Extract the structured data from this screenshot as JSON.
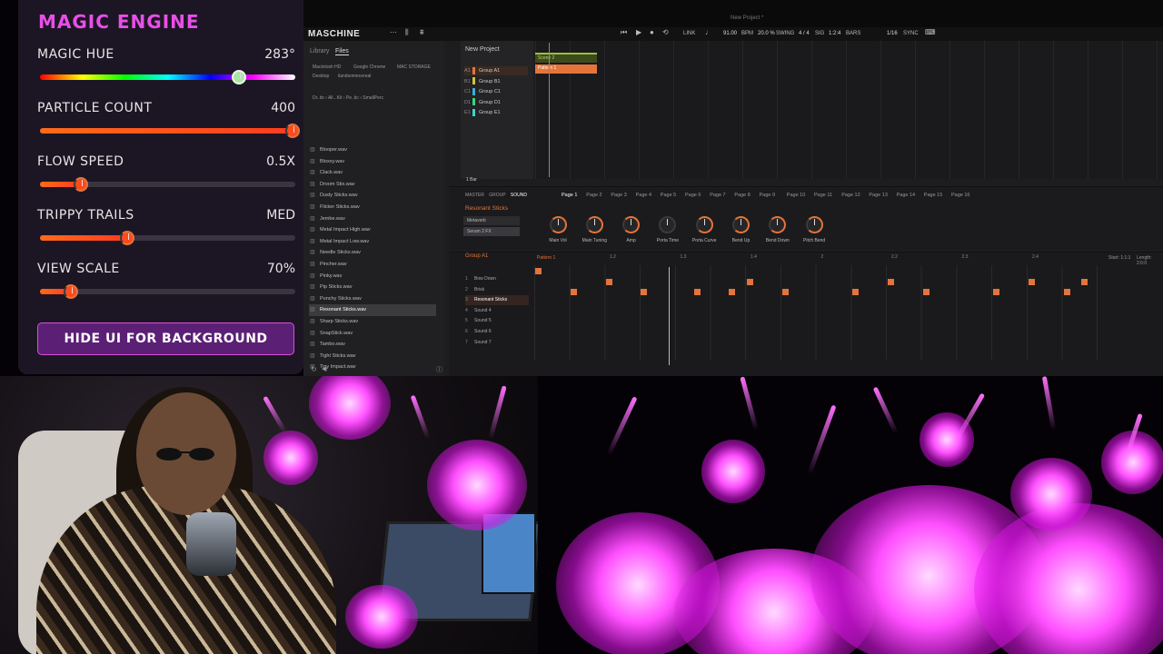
{
  "panel": {
    "title": "MAGIC ENGINE",
    "sliders": [
      {
        "label": "MAGIC HUE",
        "value": "283°",
        "level": 0.78
      },
      {
        "label": "PARTICLE COUNT",
        "value": "400",
        "level": 1.0
      },
      {
        "label": "FLOW SPEED",
        "value": "0.5X",
        "level": 0.16
      },
      {
        "label": "TRIPPY TRAILS",
        "value": "MED",
        "level": 0.34
      },
      {
        "label": "VIEW SCALE",
        "value": "70%",
        "level": 0.12
      }
    ],
    "hide_button": "HIDE UI FOR BACKGROUND"
  },
  "maschine": {
    "window_title": "New Project *",
    "brand": "MASCHINE",
    "toolbar": {
      "bpm": "91.00",
      "bpm_label": "BPM",
      "swing": "20.0 %",
      "swing_label": "SWING",
      "signature": "4 / 4",
      "signature_label": "SIG",
      "position": "1:2:4",
      "position_label": "BARS",
      "grid": "1/16",
      "sync": "SYNC",
      "link": "LINK"
    },
    "browser": {
      "tabs": [
        "Library",
        "Files"
      ],
      "locations": [
        "Macintosh HD",
        "Google Chrome",
        "MAC STORAGE",
        "Desktop",
        "ilandsomecereal"
      ],
      "path": "Dr..its › All...Kit › Pe..tic › SmallPerc",
      "files": [
        "Blooper.wav",
        "Bloxxy.wav",
        "Clack.wav",
        "Droom Stix.wav",
        "Dusty Sticks.wav",
        "Flicker Sticks.wav",
        "Jembe.wav",
        "Metal Impact High.wav",
        "Metal Impact Low.wav",
        "Needle Sticks.wav",
        "Pincher.wav",
        "Pinky.wav",
        "Pip Sticks.wav",
        "Punchy Sticks.wav",
        "Resonant Sticks.wav",
        "Sharp Sticks.wav",
        "SnapStick.wav",
        "Tambo.wav",
        "Tight Sticks.wav",
        "Tiny Impact.wav",
        "Twit Multi.wav",
        "Twit.wav"
      ],
      "selected_file": "Resonant Sticks.wav"
    },
    "project": {
      "title": "New Project",
      "groups": [
        {
          "idx": "A1",
          "name": "Group A1",
          "color": "#e4743a"
        },
        {
          "idx": "B1",
          "name": "Group B1",
          "color": "#d6c03a"
        },
        {
          "idx": "C1",
          "name": "Group C1",
          "color": "#3ab0d6"
        },
        {
          "idx": "D1",
          "name": "Group D1",
          "color": "#3ad680"
        },
        {
          "idx": "E1",
          "name": "Group E1",
          "color": "#3ad6c8"
        }
      ],
      "bar_length": "1 Bar"
    },
    "arranger": {
      "scene": "Scene 2",
      "pattern": "Pattern 1"
    },
    "control": {
      "tabs": [
        "MASTER",
        "GROUP",
        "SOUND"
      ],
      "selected_sound": "Resonant Sticks",
      "plugins": [
        "Metaverb",
        "Serum 2 FX"
      ],
      "pages": [
        "Page 1",
        "Page 2",
        "Page 3",
        "Page 4",
        "Page 5",
        "Page 6",
        "Page 7",
        "Page 8",
        "Page 9",
        "Page 10",
        "Page 11",
        "Page 12",
        "Page 13",
        "Page 14",
        "Page 15",
        "Page 16"
      ],
      "knobs": [
        "Main Vol",
        "Main Tuning",
        "Amp",
        "Porta Time",
        "Porta Curve",
        "Bend Up",
        "Bend Down",
        "Pitch Bend"
      ]
    },
    "pattern_editor": {
      "group": "Group A1",
      "pattern": "Pattern 1",
      "ruler": [
        "1.2",
        "1.3",
        "1.4",
        "2",
        "2.2",
        "2.3",
        "2.4"
      ],
      "start": "Start: 1:1:1",
      "length": "Length: 2:0:0",
      "sounds": [
        {
          "n": "1",
          "name": "Bow Down"
        },
        {
          "n": "2",
          "name": "Brisk"
        },
        {
          "n": "3",
          "name": "Resonant Sticks"
        },
        {
          "n": "4",
          "name": "Sound 4"
        },
        {
          "n": "5",
          "name": "Sound 5"
        },
        {
          "n": "6",
          "name": "Sound 6"
        },
        {
          "n": "7",
          "name": "Sound 7"
        }
      ]
    }
  },
  "colors": {
    "accent": "#e4743a",
    "magic": "#e84fe8",
    "panel_bg": "#1c1624"
  }
}
